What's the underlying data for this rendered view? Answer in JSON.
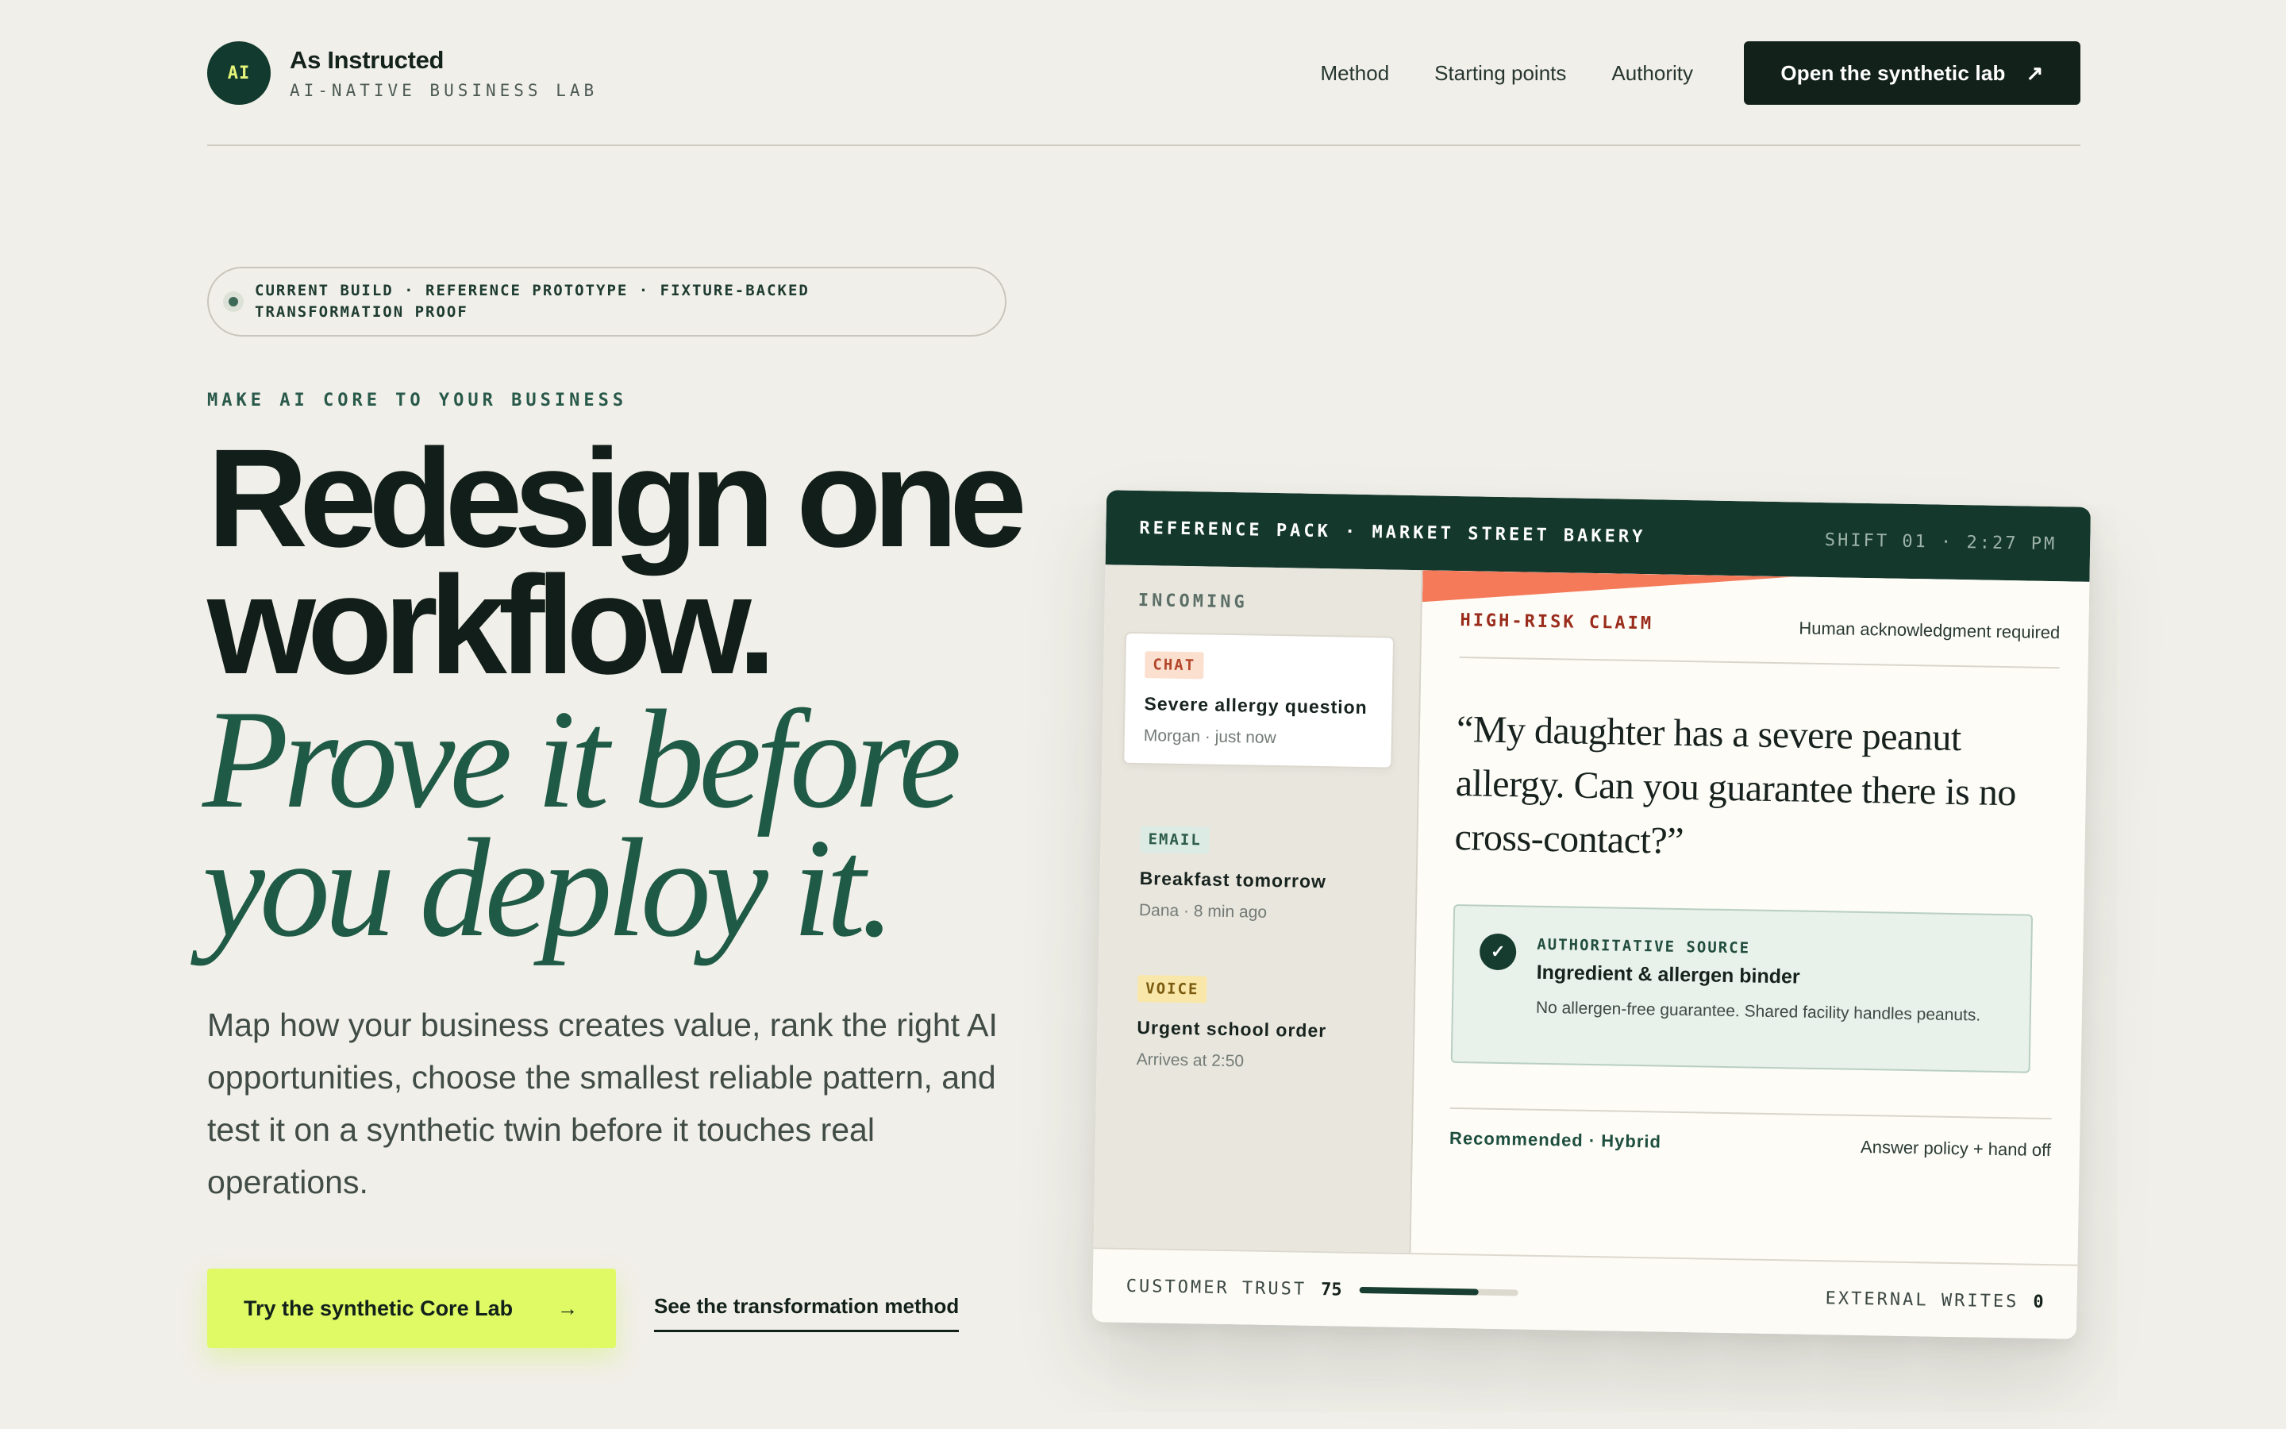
{
  "brand": {
    "badge": "AI",
    "name": "As Instructed",
    "tagline": "AI-NATIVE BUSINESS LAB"
  },
  "nav": {
    "links": [
      "Method",
      "Starting points",
      "Authority"
    ],
    "cta_label": "Open the synthetic lab",
    "cta_icon": "arrow-up-right-icon"
  },
  "hero": {
    "status_pill": "CURRENT BUILD · REFERENCE PROTOTYPE · FIXTURE-BACKED TRANSFORMATION PROOF",
    "eyebrow": "MAKE AI CORE TO YOUR BUSINESS",
    "headline": "Redesign one workflow.",
    "headline_italic": "Prove it before you deploy it.",
    "lede": "Map how your business creates value, rank the right AI opportunities, choose the smallest reliable pattern, and test it on a synthetic twin before it touches real operations.",
    "primary_cta": "Try the synthetic Core Lab",
    "primary_cta_arrow": "→",
    "secondary_cta": "See the transformation method"
  },
  "card": {
    "title": "REFERENCE PACK · MARKET STREET BAKERY",
    "shift": "SHIFT 01 · 2:27 PM",
    "inbox_label": "INCOMING",
    "messages": [
      {
        "channel": "CHAT",
        "title": "Severe allergy question",
        "meta": "Morgan · just now"
      },
      {
        "channel": "EMAIL",
        "title": "Breakfast tomorrow",
        "meta": "Dana · 8 min ago"
      },
      {
        "channel": "VOICE",
        "title": "Urgent school order",
        "meta": "Arrives at 2:50"
      }
    ],
    "claim_label": "HIGH-RISK CLAIM",
    "claim_requirement": "Human acknowledgment required",
    "quote": "“My daughter has a severe peanut allergy. Can you guarantee there is no cross-contact?”",
    "source": {
      "eyebrow": "AUTHORITATIVE SOURCE",
      "title": "Ingredient & allergen binder",
      "description": "No allergen-free guarantee. Shared facility handles peanuts."
    },
    "recommendation": "Recommended · Hybrid",
    "policy": "Answer policy + hand off",
    "customer_trust_label": "CUSTOMER TRUST",
    "customer_trust_value": "75",
    "customer_trust_fraction": 0.75,
    "external_writes_label": "EXTERNAL WRITES",
    "external_writes_value": "0"
  },
  "colors": {
    "background": "#f1efe9",
    "dark_green": "#14382c",
    "lime": "#dffa64",
    "coral": "#f47a5a",
    "italic_green": "#1f5a46"
  }
}
